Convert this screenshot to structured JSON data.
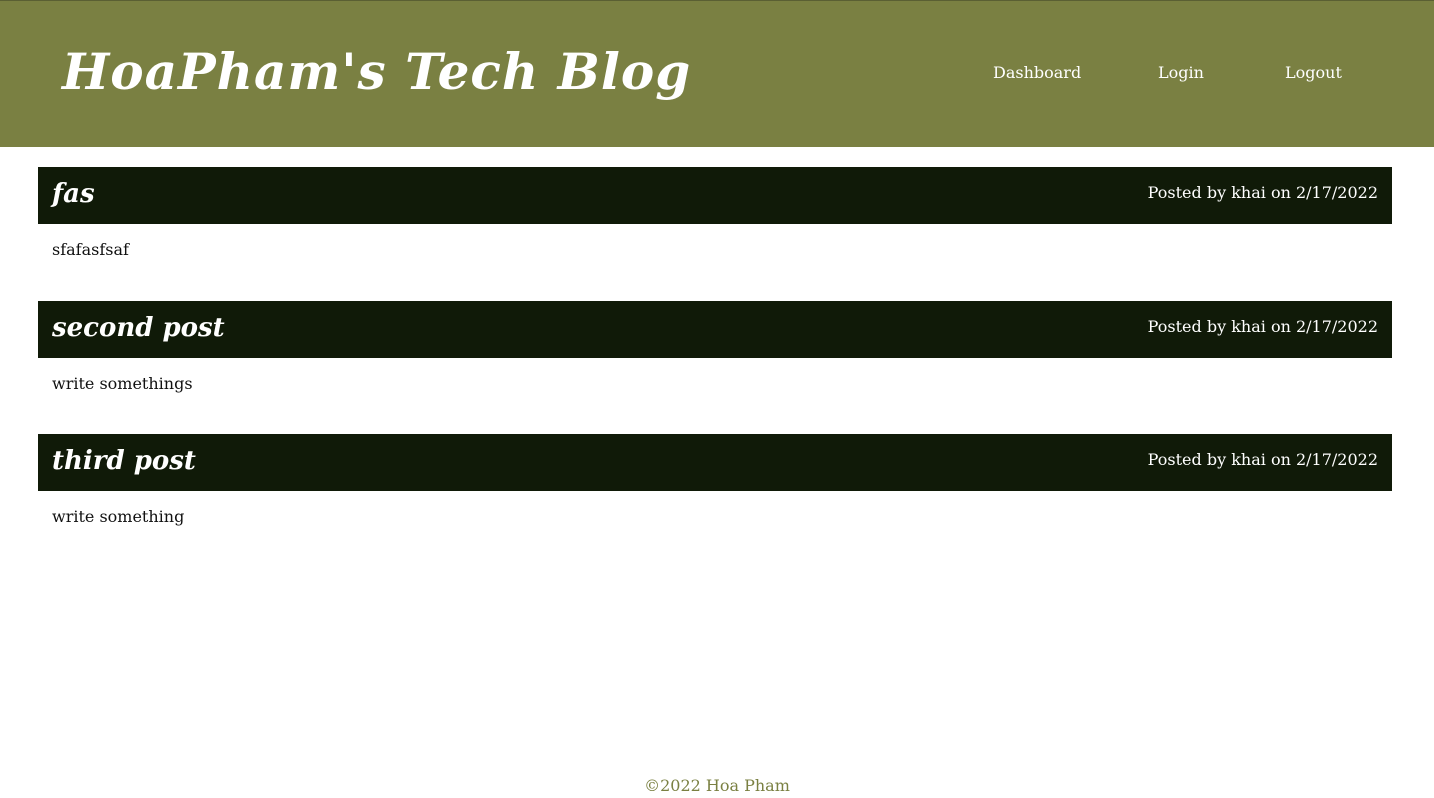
{
  "header": {
    "title": "HoaPham's Tech Blog",
    "nav": [
      {
        "label": "Dashboard"
      },
      {
        "label": "Login"
      },
      {
        "label": "Logout"
      }
    ]
  },
  "posts": [
    {
      "title": "fas",
      "meta": "Posted by khai on 2/17/2022",
      "body": "sfafasfsaf"
    },
    {
      "title": "second post",
      "meta": "Posted by khai on 2/17/2022",
      "body": "write somethings"
    },
    {
      "title": "third post",
      "meta": "Posted by khai on 2/17/2022",
      "body": "write something"
    }
  ],
  "footer": {
    "copyright": "©2022 Hoa Pham"
  },
  "colors": {
    "header_bg": "#7a8042",
    "post_header_bg": "#101a08",
    "footer_text": "#7a8042"
  }
}
